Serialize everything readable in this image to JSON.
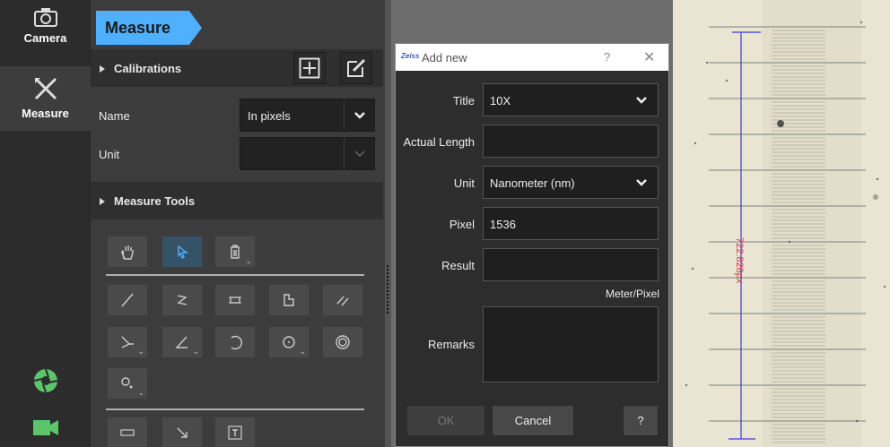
{
  "nav": {
    "camera_label": "Camera",
    "measure_label": "Measure"
  },
  "panel": {
    "tab_label": "Measure",
    "calibrations_header": "Calibrations",
    "name_label": "Name",
    "name_value": "In pixels",
    "unit_label": "Unit",
    "unit_value": "",
    "tools_header": "Measure Tools"
  },
  "dialog": {
    "logo_text": "Zeiss",
    "title": "Add new",
    "help_glyph": "?",
    "close_glyph": "✕",
    "fields": {
      "title_label": "Title",
      "title_value": "10X",
      "actual_length_label": "Actual Length",
      "actual_length_value": "",
      "unit_label": "Unit",
      "unit_value": "Nanometer (nm)",
      "pixel_label": "Pixel",
      "pixel_value": "1536",
      "result_label": "Result",
      "result_value": "",
      "result_unit": "Meter/Pixel",
      "remarks_label": "Remarks",
      "remarks_value": ""
    },
    "buttons": {
      "ok": "OK",
      "cancel": "Cancel",
      "help": "?"
    }
  },
  "image": {
    "measurement_label": "722.828px"
  },
  "colors": {
    "accent": "#4fb0ff",
    "selected_tool": "#355266",
    "shutter_green": "#5cc46a",
    "measure_line": "#3a3ae0",
    "measure_text": "#d8343a"
  },
  "icons": {
    "camera": "camera-icon",
    "measure": "crossed-tools-icon",
    "shutter": "aperture-icon",
    "video": "video-camera-icon"
  }
}
